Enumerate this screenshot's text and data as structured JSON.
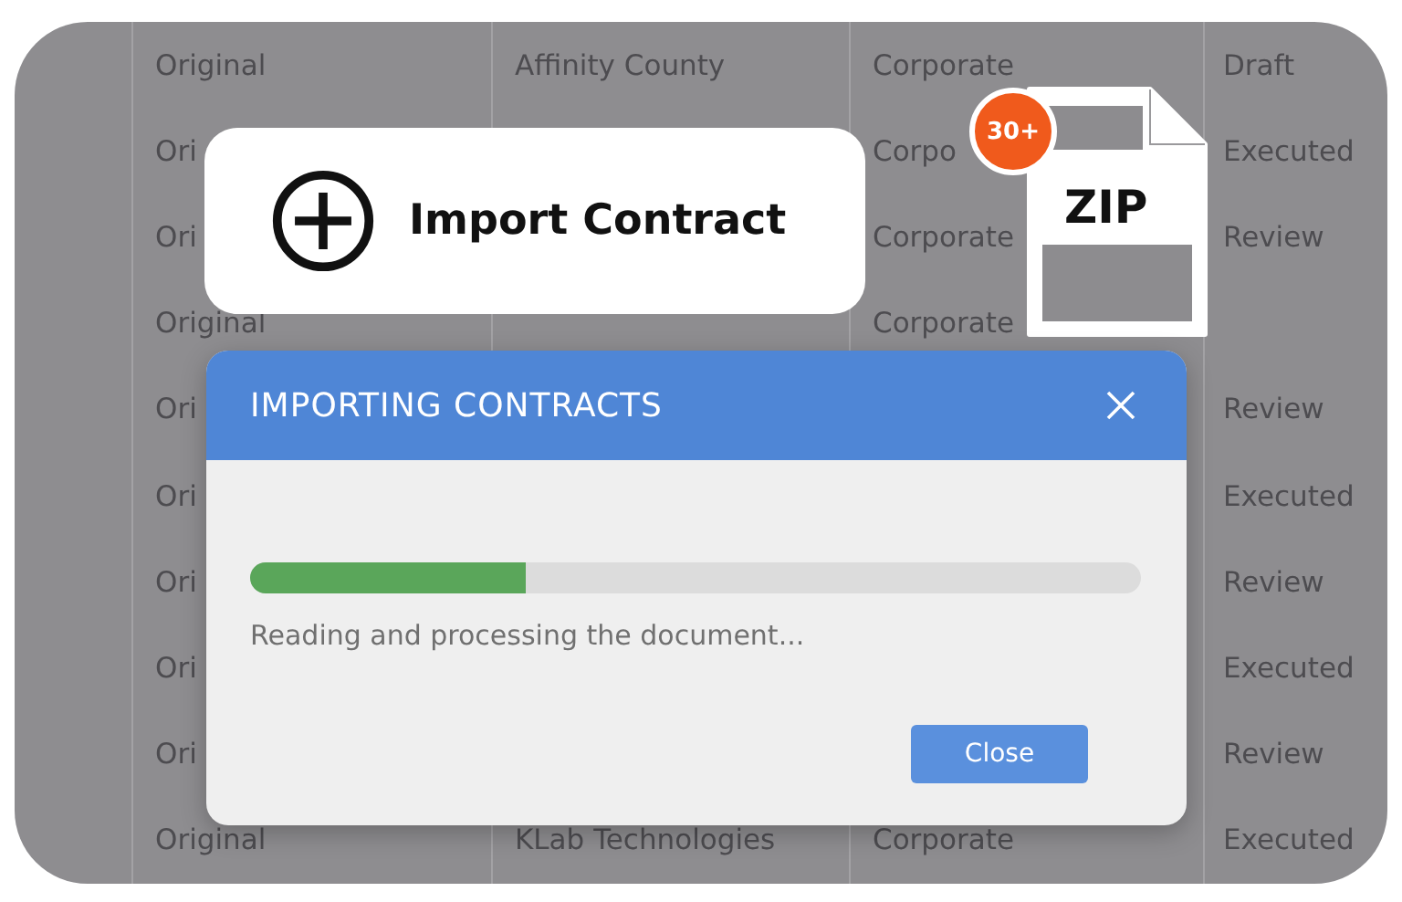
{
  "table": {
    "rows": [
      {
        "column_2": "Original",
        "column_3": "Affinity County",
        "column_4": "Corporate",
        "column_5": "Draft"
      },
      {
        "column_2": "Ori",
        "column_4": "Corpo",
        "column_5": "Executed"
      },
      {
        "column_2": "Ori",
        "column_4": "Corporate",
        "column_5": "Review"
      },
      {
        "column_2": "Original",
        "column_4": "Corporate"
      },
      {
        "column_2": "Ori",
        "column_5": "Review"
      },
      {
        "column_2": "Ori",
        "column_5": "Executed"
      },
      {
        "column_2": "Ori",
        "column_5": "Review"
      },
      {
        "column_2": "Ori",
        "column_5": "Executed"
      },
      {
        "column_2": "Ori",
        "column_5": "Review"
      },
      {
        "column_2": "Original",
        "column_3": "KLab Technologies",
        "column_4": "Corporate",
        "column_5": "Executed"
      }
    ]
  },
  "import_card": {
    "label": "Import Contract"
  },
  "file_badge": {
    "count": "30+",
    "type": "ZIP"
  },
  "dialog": {
    "title": "IMPORTING CONTRACTS",
    "progress": {
      "level": 0.31
    },
    "status": "Reading and processing the document...",
    "buttons": [
      "Close"
    ]
  }
}
